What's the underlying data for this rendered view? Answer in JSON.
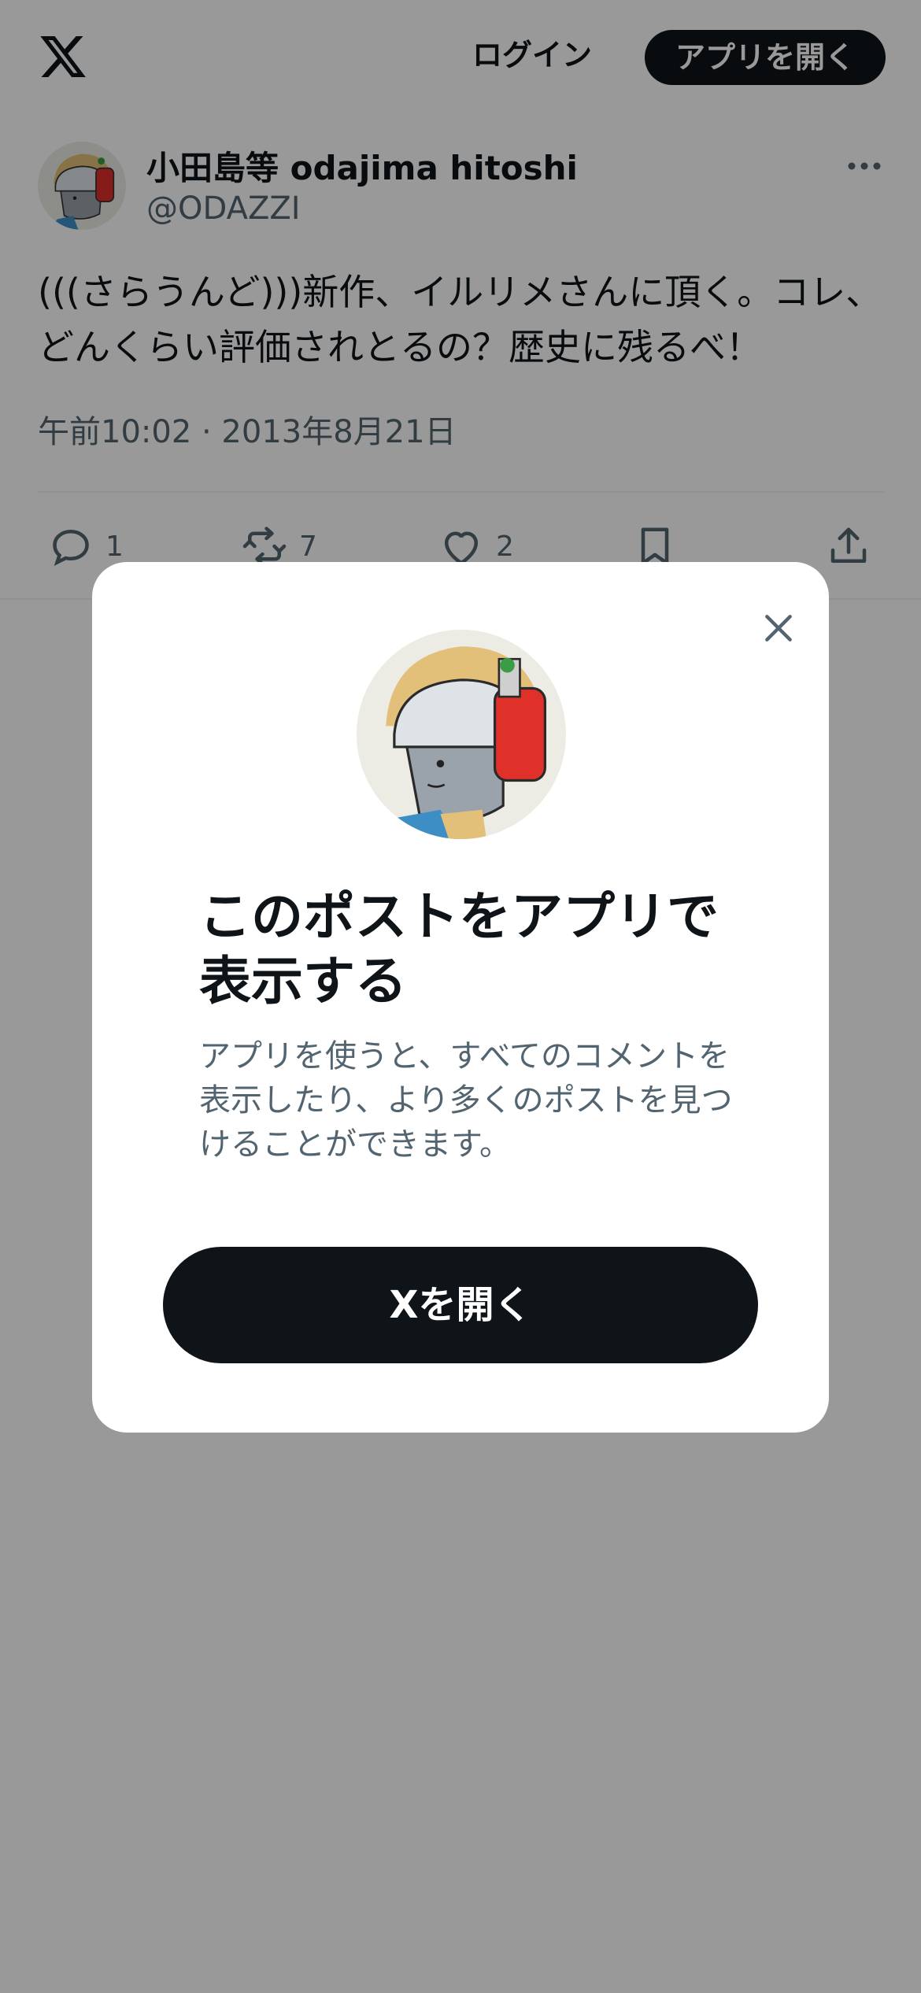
{
  "header": {
    "logo_icon": "x-logo-icon",
    "login_label": "ログイン",
    "open_app_label": "アプリを開く"
  },
  "post": {
    "display_name": "小田島等 odajima hitoshi",
    "handle": "@ODAZZI",
    "text": "(((さらうんど)))新作、イルリメさんに頂く。コレ、どんくらい評価されとるの？歴史に残るべ！",
    "timestamp": "午前10:02 · 2013年8月21日",
    "more_icon": "more-horizontal-icon",
    "actions": {
      "reply": {
        "icon": "reply-icon",
        "count": "1"
      },
      "repost": {
        "icon": "repost-icon",
        "count": "7"
      },
      "like": {
        "icon": "heart-icon",
        "count": "2"
      },
      "bookmark": {
        "icon": "bookmark-icon"
      },
      "share": {
        "icon": "share-icon"
      }
    }
  },
  "modal": {
    "close_icon": "close-icon",
    "title": "このポストをアプリで表示する",
    "description": "アプリを使うと、すべてのコメントを表示したり、より多くのポストを見つけることができます。",
    "button_label": "Xを開く"
  },
  "colors": {
    "text_primary": "#0f1419",
    "text_secondary": "#536471",
    "button_dark": "#0f1419",
    "overlay": "rgba(0,0,0,0.4)",
    "background": "#ffffff"
  }
}
